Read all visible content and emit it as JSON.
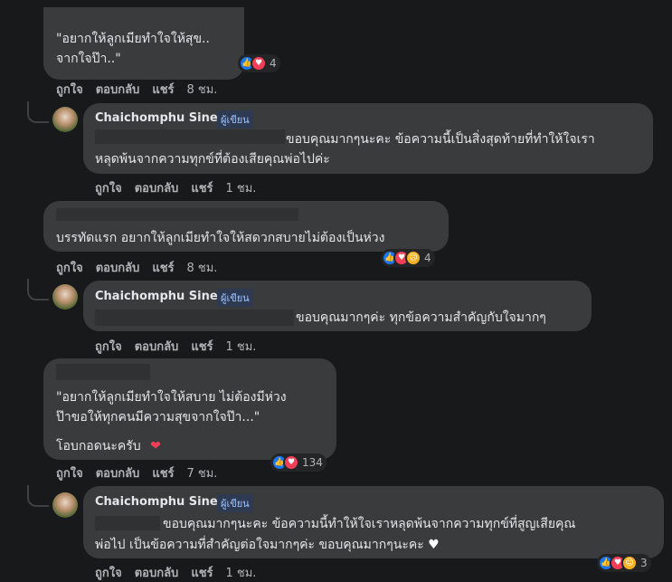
{
  "colors": {
    "background": "#18191a",
    "bubble": "#3a3b3c",
    "text": "#e4e6eb",
    "muted": "#b0b3b8",
    "like": "#1877f2",
    "love": "#f33e58",
    "author_badge": "#a0c4ff"
  },
  "comments": [
    {
      "lines": [
        "\"อยากให้ลูกเมียทำใจให้สุข..",
        "จากใจป๊า..\""
      ],
      "reactions": {
        "icons": [
          "like-icon",
          "love-icon"
        ],
        "count": "4"
      },
      "actions": {
        "like": "ถูกใจ",
        "reply": "ตอบกลับ",
        "share": "แชร์",
        "time": "8 ชม."
      }
    },
    {
      "author": "Chaichomphu Sine",
      "badge": "ผู้เขียน",
      "lines": [
        "ขอบคุณมากๆนะคะ ข้อความนี้เป็นสิ่งสุดท้ายที่ทำให้ใจเรา",
        "หลุดพ้นจากความทุกข์ที่ต้องเสียคุณพ่อไปค่ะ"
      ],
      "actions": {
        "like": "ถูกใจ",
        "reply": "ตอบกลับ",
        "share": "แชร์",
        "time": "1 ชม."
      }
    },
    {
      "lines": [
        "บรรทัดแรก อยากให้ลูกเมียทำใจให้สดวกสบายไม่ต้องเป็นห่วง"
      ],
      "reactions": {
        "icons": [
          "like-icon",
          "love-icon",
          "sad-icon"
        ],
        "count": "4"
      },
      "actions": {
        "like": "ถูกใจ",
        "reply": "ตอบกลับ",
        "share": "แชร์",
        "time": "8 ชม."
      }
    },
    {
      "author": "Chaichomphu Sine",
      "badge": "ผู้เขียน",
      "lines": [
        "ขอบคุณมากๆค่ะ ทุกข้อความสำคัญกับใจมากๆ"
      ],
      "actions": {
        "like": "ถูกใจ",
        "reply": "ตอบกลับ",
        "share": "แชร์",
        "time": "1 ชม."
      }
    },
    {
      "lines": [
        "\"อยากให้ลูกเมียทำใจให้สบาย ไม่ต้องมีห่วง",
        "ป๊าขอให้ทุกคนมีความสุขจากใจป๊า...\""
      ],
      "extra": "โอบกอดนะครับ",
      "reactions": {
        "icons": [
          "like-icon",
          "love-icon"
        ],
        "count": "134"
      },
      "actions": {
        "like": "ถูกใจ",
        "reply": "ตอบกลับ",
        "share": "แชร์",
        "time": "7 ชม."
      }
    },
    {
      "author": "Chaichomphu Sine",
      "badge": "ผู้เขียน",
      "lines": [
        "ขอบคุณมากๆนะคะ ข้อความนี้ทำให้ใจเราหลุดพ้นจากความทุกข์ที่สูญเสียคุณ",
        "พ่อไป เป็นข้อความที่สำคัญต่อใจมากๆค่ะ ขอบคุณมากๆนะคะ"
      ],
      "reactions": {
        "icons": [
          "like-icon",
          "love-icon",
          "care-icon"
        ],
        "count": "3"
      },
      "actions": {
        "like": "ถูกใจ",
        "reply": "ตอบกลับ",
        "share": "แชร์",
        "time": "1 ชม."
      }
    }
  ]
}
